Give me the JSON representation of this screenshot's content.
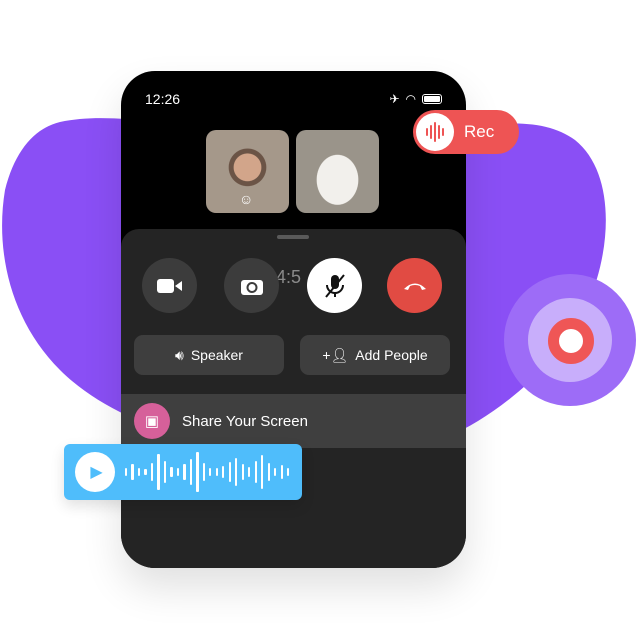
{
  "colors": {
    "blob": "#8a4ff5",
    "rec": "#ee5454",
    "audio": "#4fbdfb",
    "share_icon": "#d6609a",
    "end_call": "#e14b43"
  },
  "status": {
    "time": "12:26",
    "icons": [
      "airplane-icon",
      "wifi-icon",
      "battery-icon"
    ]
  },
  "call": {
    "timer": "34:5"
  },
  "controls": [
    {
      "name": "video-camera-button",
      "icon": "video-icon"
    },
    {
      "name": "flip-camera-button",
      "icon": "camera-rotate-icon"
    },
    {
      "name": "mute-button",
      "icon": "mic-off-icon",
      "active": true
    },
    {
      "name": "end-call-button",
      "icon": "phone-hangup-icon"
    }
  ],
  "actions": {
    "speaker": "Speaker",
    "add_people": "Add People"
  },
  "share": {
    "label": "Share Your Screen"
  },
  "rec": {
    "label": "Rec"
  }
}
